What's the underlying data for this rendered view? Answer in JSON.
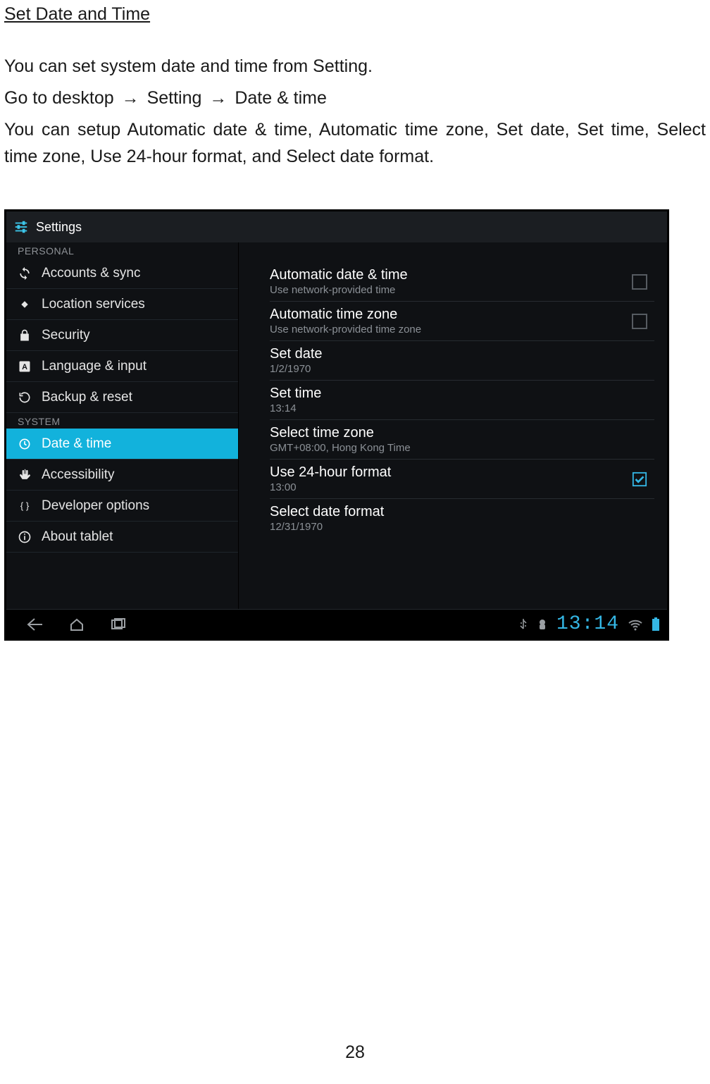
{
  "doc": {
    "heading": "Set Date and Time",
    "para1": "You can set system date and time from Setting.",
    "para2_pre": "Go to desktop",
    "para2_mid": "Setting",
    "para2_end": "Date & time",
    "para3": "You can setup Automatic date & time, Automatic time zone, Set date, Set time, Select time zone, Use 24-hour format, and Select date format.",
    "page_number": "28"
  },
  "app": {
    "title": "Settings"
  },
  "sidebar": {
    "section_personal": "PERSONAL",
    "section_system": "SYSTEM",
    "items": {
      "accounts": "Accounts & sync",
      "location": "Location services",
      "security": "Security",
      "language": "Language & input",
      "backup": "Backup & reset",
      "datetime": "Date & time",
      "accessibility": "Accessibility",
      "developer": "Developer options",
      "about": "About tablet"
    }
  },
  "settings": {
    "auto_date": {
      "title": "Automatic date & time",
      "sub": "Use network-provided time"
    },
    "auto_tz": {
      "title": "Automatic time zone",
      "sub": "Use network-provided time zone"
    },
    "set_date": {
      "title": "Set date",
      "sub": "1/2/1970"
    },
    "set_time": {
      "title": "Set time",
      "sub": "13:14"
    },
    "tz": {
      "title": "Select time zone",
      "sub": "GMT+08:00, Hong Kong Time"
    },
    "h24": {
      "title": "Use 24-hour format",
      "sub": "13:00"
    },
    "dformat": {
      "title": "Select date format",
      "sub": "12/31/1970"
    }
  },
  "status": {
    "clock": "13:14"
  }
}
